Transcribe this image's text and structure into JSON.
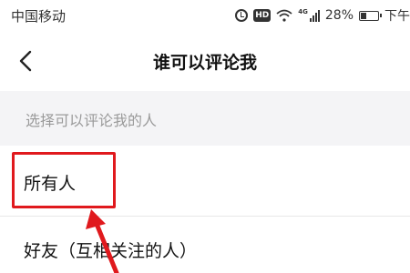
{
  "status_bar": {
    "carrier": "中国移动",
    "network_tag": "4G",
    "hd_badge": "HD",
    "battery_percent": "28%",
    "battery_level": 0.28,
    "clock_partial": "下午"
  },
  "nav": {
    "title": "谁可以评论我",
    "back_icon": "chevron-left-icon"
  },
  "section": {
    "header": "选择可以评论我的人"
  },
  "options": [
    {
      "label": "所有人",
      "highlighted": true
    },
    {
      "label": "好友（互相关注的人）",
      "highlighted": false
    }
  ],
  "annotation": {
    "color": "#e0191d"
  }
}
